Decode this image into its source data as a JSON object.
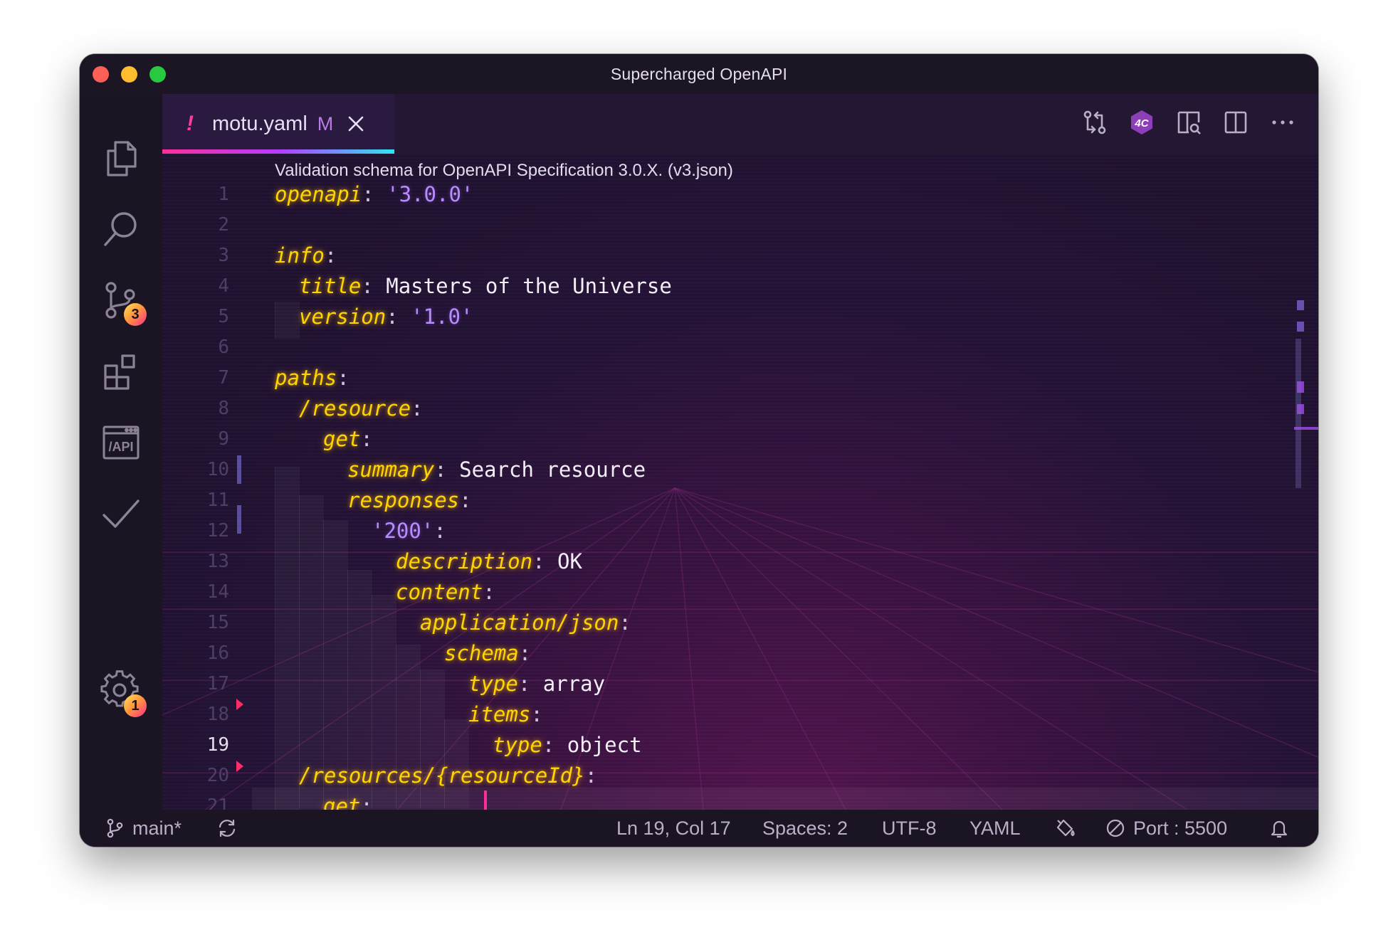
{
  "window": {
    "title": "Supercharged OpenAPI"
  },
  "activity_bar": {
    "items": [
      {
        "icon": "files-icon"
      },
      {
        "icon": "search-icon"
      },
      {
        "icon": "source-control-icon",
        "badge": "3"
      },
      {
        "icon": "extensions-icon"
      },
      {
        "icon": "api-icon",
        "label": "/API"
      },
      {
        "icon": "check-icon"
      }
    ],
    "settings": {
      "icon": "gear-icon",
      "badge": "1"
    }
  },
  "tab": {
    "warning_glyph": "!",
    "filename": "motu.yaml",
    "modified": "M",
    "close_icon": "close-icon"
  },
  "tab_actions": [
    "compare-changes-icon",
    "api-extension-icon",
    "open-preview-icon",
    "split-editor-icon",
    "more-actions-icon"
  ],
  "editor": {
    "breadcrumb": "Validation schema for OpenAPI Specification 3.0.X. (v3.json)",
    "current_line": "19",
    "lines": [
      {
        "n": "1",
        "key": "openapi",
        "sep": ": ",
        "value": "'3.0.0'",
        "vtype": "s"
      },
      {
        "n": "2",
        "key": "",
        "sep": "",
        "value": "",
        "vtype": "v"
      },
      {
        "n": "3",
        "key": "info",
        "sep": ":",
        "value": "",
        "vtype": "v"
      },
      {
        "n": "4",
        "key": "title",
        "sep": ": ",
        "value": "Masters of the Universe",
        "vtype": "v"
      },
      {
        "n": "5",
        "key": "version",
        "sep": ": ",
        "value": "'1.0'",
        "vtype": "s"
      },
      {
        "n": "6",
        "key": "",
        "sep": "",
        "value": "",
        "vtype": "v"
      },
      {
        "n": "7",
        "key": "paths",
        "sep": ":",
        "value": "",
        "vtype": "v"
      },
      {
        "n": "8",
        "key": "/resource",
        "sep": ":",
        "value": "",
        "vtype": "v"
      },
      {
        "n": "9",
        "key": "get",
        "sep": ":",
        "value": "",
        "vtype": "v"
      },
      {
        "n": "10",
        "key": "summary",
        "sep": ": ",
        "value": "Search resource",
        "vtype": "v"
      },
      {
        "n": "11",
        "key": "responses",
        "sep": ":",
        "value": "",
        "vtype": "v"
      },
      {
        "n": "12",
        "key": "",
        "sep": ":",
        "value": "'200'",
        "vtype": "s"
      },
      {
        "n": "13",
        "key": "description",
        "sep": ": ",
        "value": "OK",
        "vtype": "v"
      },
      {
        "n": "14",
        "key": "content",
        "sep": ":",
        "value": "",
        "vtype": "v"
      },
      {
        "n": "15",
        "key": "application/json",
        "sep": ":",
        "value": "",
        "vtype": "v"
      },
      {
        "n": "16",
        "key": "schema",
        "sep": ":",
        "value": "",
        "vtype": "v"
      },
      {
        "n": "17",
        "key": "type",
        "sep": ": ",
        "value": "array",
        "vtype": "v"
      },
      {
        "n": "18",
        "key": "items",
        "sep": ":",
        "value": "",
        "vtype": "v"
      },
      {
        "n": "19",
        "key": "type",
        "sep": ": ",
        "value": "object",
        "vtype": "v"
      },
      {
        "n": "20",
        "key": "/resources/{resourceId}",
        "sep": ":",
        "value": "",
        "vtype": "v"
      },
      {
        "n": "21",
        "key": "get",
        "sep": ":",
        "value": "",
        "vtype": "v"
      }
    ]
  },
  "status_bar": {
    "branch_icon": "git-branch-icon",
    "branch": "main*",
    "sync_icon": "sync-icon",
    "cursor_position": "Ln 19, Col 17",
    "indentation": "Spaces: 2",
    "encoding": "UTF-8",
    "language": "YAML",
    "feedback_icon": "paint-bucket-icon",
    "port_icon": "no-entry-icon",
    "port": "Port : 5500",
    "bell_icon": "bell-icon"
  },
  "colors": {
    "keyword": "#ffd400",
    "string": "#b88cff",
    "accent": "#ff2e9b",
    "badge": "#ffd23f"
  }
}
